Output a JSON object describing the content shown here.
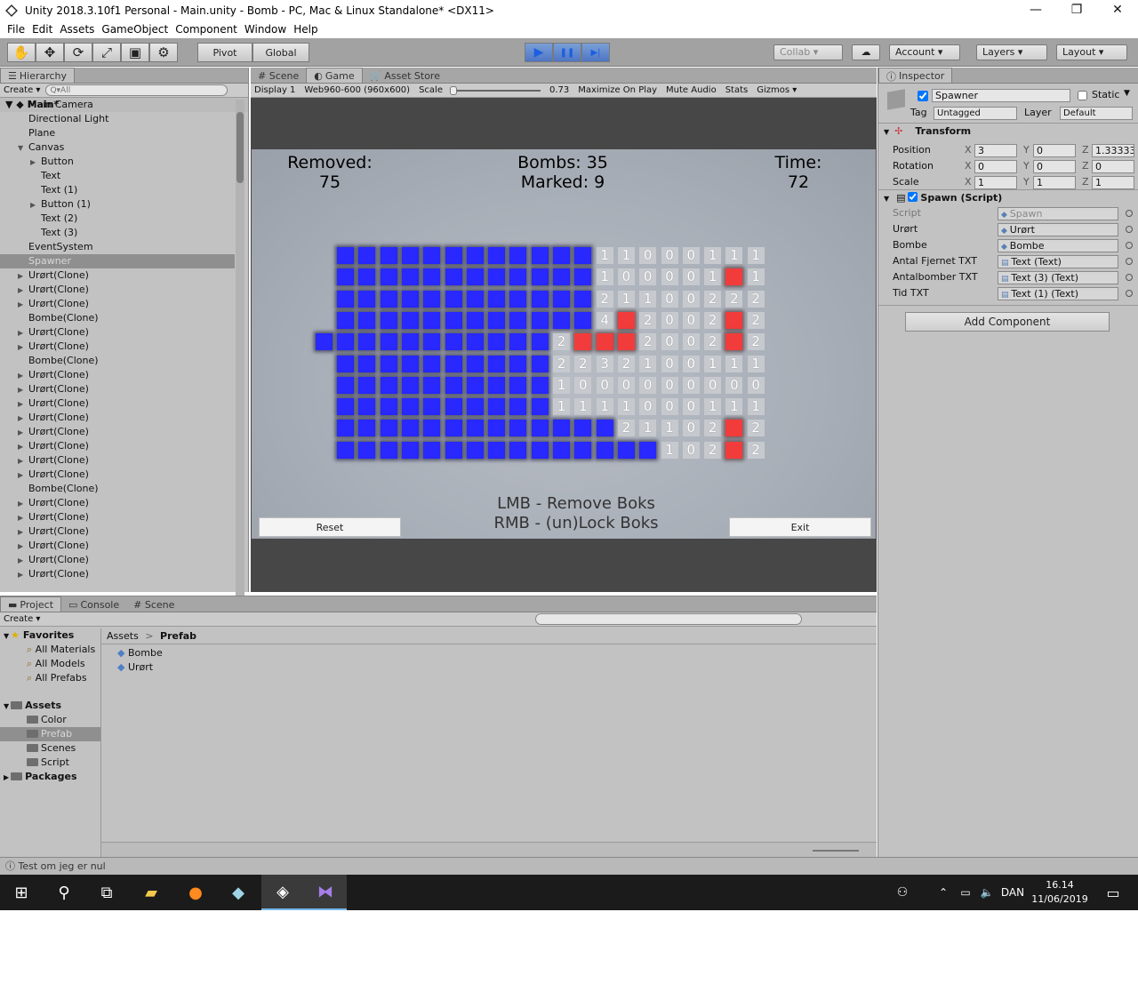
{
  "window": {
    "title": "Unity 2018.3.10f1 Personal - Main.unity - Bomb - PC, Mac & Linux Standalone* <DX11>",
    "minimize": "—",
    "maximize": "❐",
    "close": "✕"
  },
  "menu": [
    "File",
    "Edit",
    "Assets",
    "GameObject",
    "Component",
    "Window",
    "Help"
  ],
  "toolbar": {
    "tools": [
      "✋",
      "✥",
      "⟳",
      "⤢",
      "▣",
      "⚙"
    ],
    "pivot": "Pivot",
    "global": "Global",
    "play": "▶",
    "pause": "❚❚",
    "step": "▶|",
    "collab": "Collab ▾",
    "cloud": "☁",
    "account": "Account ▾",
    "layers": "Layers ▾",
    "layout": "Layout ▾"
  },
  "hierarchy": {
    "tab": "Hierarchy",
    "create": "Create ▾",
    "search_placeholder": "Q▾All",
    "scene": "Main*",
    "items": [
      {
        "label": "Main Camera",
        "indent": 1,
        "arrow": ""
      },
      {
        "label": "Directional Light",
        "indent": 1,
        "arrow": ""
      },
      {
        "label": "Plane",
        "indent": 1,
        "arrow": ""
      },
      {
        "label": "Canvas",
        "indent": 1,
        "arrow": "▼"
      },
      {
        "label": "Button",
        "indent": 2,
        "arrow": "▶"
      },
      {
        "label": "Text",
        "indent": 2,
        "arrow": ""
      },
      {
        "label": "Text (1)",
        "indent": 2,
        "arrow": ""
      },
      {
        "label": "Button (1)",
        "indent": 2,
        "arrow": "▶"
      },
      {
        "label": "Text (2)",
        "indent": 2,
        "arrow": ""
      },
      {
        "label": "Text (3)",
        "indent": 2,
        "arrow": ""
      },
      {
        "label": "EventSystem",
        "indent": 1,
        "arrow": ""
      },
      {
        "label": "Spawner",
        "indent": 1,
        "arrow": "",
        "selected": true
      },
      {
        "label": "Urørt(Clone)",
        "indent": 1,
        "arrow": "▶"
      },
      {
        "label": "Urørt(Clone)",
        "indent": 1,
        "arrow": "▶"
      },
      {
        "label": "Urørt(Clone)",
        "indent": 1,
        "arrow": "▶"
      },
      {
        "label": "Bombe(Clone)",
        "indent": 1,
        "arrow": ""
      },
      {
        "label": "Urørt(Clone)",
        "indent": 1,
        "arrow": "▶"
      },
      {
        "label": "Urørt(Clone)",
        "indent": 1,
        "arrow": "▶"
      },
      {
        "label": "Bombe(Clone)",
        "indent": 1,
        "arrow": ""
      },
      {
        "label": "Urørt(Clone)",
        "indent": 1,
        "arrow": "▶"
      },
      {
        "label": "Urørt(Clone)",
        "indent": 1,
        "arrow": "▶"
      },
      {
        "label": "Urørt(Clone)",
        "indent": 1,
        "arrow": "▶"
      },
      {
        "label": "Urørt(Clone)",
        "indent": 1,
        "arrow": "▶"
      },
      {
        "label": "Urørt(Clone)",
        "indent": 1,
        "arrow": "▶"
      },
      {
        "label": "Urørt(Clone)",
        "indent": 1,
        "arrow": "▶"
      },
      {
        "label": "Urørt(Clone)",
        "indent": 1,
        "arrow": "▶"
      },
      {
        "label": "Urørt(Clone)",
        "indent": 1,
        "arrow": "▶"
      },
      {
        "label": "Bombe(Clone)",
        "indent": 1,
        "arrow": ""
      },
      {
        "label": "Urørt(Clone)",
        "indent": 1,
        "arrow": "▶"
      },
      {
        "label": "Urørt(Clone)",
        "indent": 1,
        "arrow": "▶"
      },
      {
        "label": "Urørt(Clone)",
        "indent": 1,
        "arrow": "▶"
      },
      {
        "label": "Urørt(Clone)",
        "indent": 1,
        "arrow": "▶"
      },
      {
        "label": "Urørt(Clone)",
        "indent": 1,
        "arrow": "▶"
      },
      {
        "label": "Urørt(Clone)",
        "indent": 1,
        "arrow": "▶"
      }
    ]
  },
  "game_tabs": {
    "scene": "# Scene",
    "game": "Game",
    "asset_store": "Asset Store"
  },
  "game_bar": {
    "display": "Display 1",
    "resolution": "Web960-600 (960x600)",
    "scale_label": "Scale",
    "scale_value": "0.73",
    "maximize": "Maximize On Play",
    "mute": "Mute Audio",
    "stats": "Stats",
    "gizmos": "Gizmos ▾"
  },
  "game": {
    "removed_label": "Removed:",
    "removed_value": "75",
    "bombs_label": "Bombs: 35",
    "marked_label": "Marked: 9",
    "time_label": "Time:",
    "time_value": "72",
    "help1": "LMB - Remove Boks",
    "help2": "RMB - (un)Lock Boks",
    "reset": "Reset",
    "exit": "Exit",
    "colors": {
      "covered": "#2828ff",
      "marked": "#f23c3c",
      "revealed": "#c6c9ce"
    },
    "grid": [
      "BBBBBBBBBBBB11000111",
      "BBBBBBBBBBBB100001M1",
      "BBBBBBBBBBBB21100222",
      "BBBBBBBBBBBB4M2002M2",
      "BBBBBBBBBBB2MMM2002M2",
      "BBBBBBBBBB2232100111",
      "BBBBBBBBBB1000000000",
      "BBBBBBBBBB1111000111",
      "BBBBBBBBBBBBB21102M2",
      "BBBBBBBBBBBBBBB102M2"
    ]
  },
  "project": {
    "tabs": [
      "Project",
      "Console",
      "# Scene"
    ],
    "create": "Create ▾",
    "favorites": "Favorites",
    "fav_items": [
      "All Materials",
      "All Models",
      "All Prefabs"
    ],
    "assets": "Assets",
    "asset_folders": [
      "Color",
      "Prefab",
      "Scenes",
      "Script"
    ],
    "packages": "Packages",
    "breadcrumb_root": "Assets",
    "breadcrumb_sep": ">",
    "breadcrumb_current": "Prefab",
    "files": [
      "Bombe",
      "Urørt"
    ]
  },
  "inspector": {
    "tab": "Inspector",
    "name": "Spawner",
    "static": "Static",
    "tag_label": "Tag",
    "tag": "Untagged",
    "layer_label": "Layer",
    "layer": "Default",
    "transform": "Transform",
    "position_label": "Position",
    "position": [
      "3",
      "0",
      "1.33333"
    ],
    "rotation_label": "Rotation",
    "rotation": [
      "0",
      "0",
      "0"
    ],
    "scale_label": "Scale",
    "scale": [
      "1",
      "1",
      "1"
    ],
    "spawn": "Spawn (Script)",
    "fields": [
      {
        "label": "Script",
        "value": "Spawn"
      },
      {
        "label": "Urørt",
        "value": "Urørt"
      },
      {
        "label": "Bombe",
        "value": "Bombe"
      },
      {
        "label": "Antal Fjernet TXT",
        "value": "Text (Text)"
      },
      {
        "label": "Antalbomber TXT",
        "value": "Text (3) (Text)"
      },
      {
        "label": "Tid TXT",
        "value": "Text (1) (Text)"
      }
    ],
    "add_component": "Add Component"
  },
  "status": "Test om jeg er nul",
  "taskbar": {
    "lang": "DAN",
    "time": "16.14",
    "date": "11/06/2019"
  }
}
